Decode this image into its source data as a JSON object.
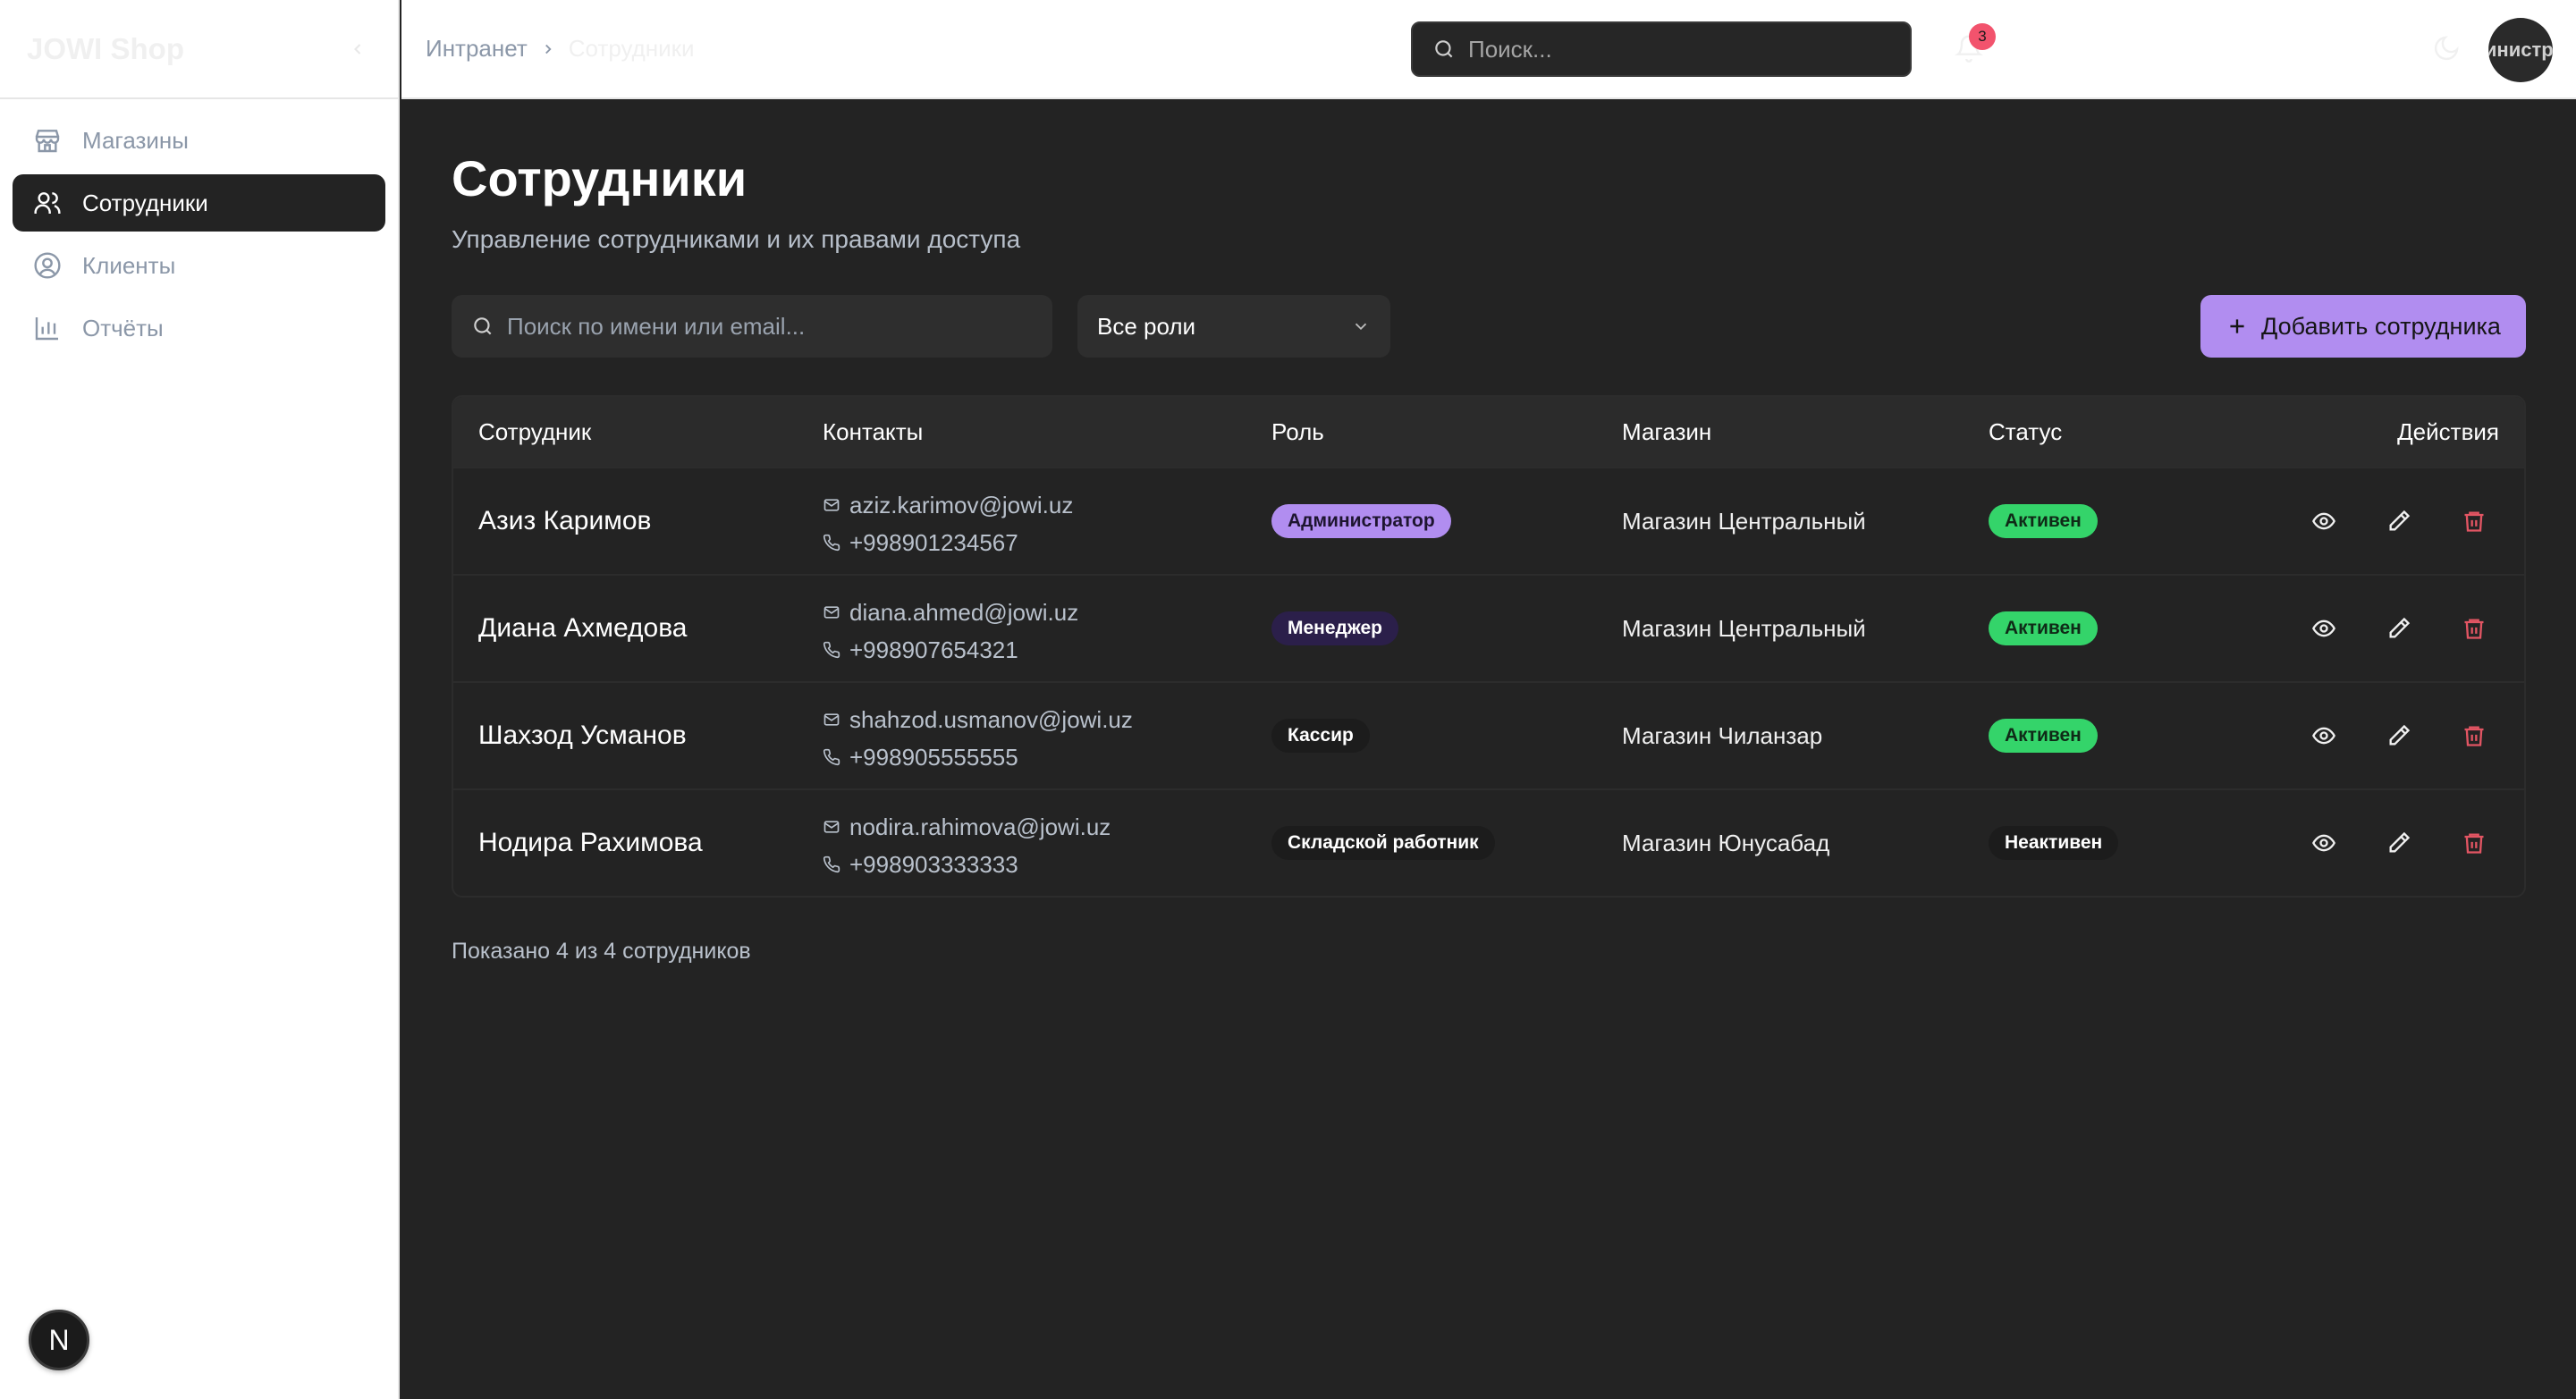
{
  "app": {
    "brand": "JOWI Shop"
  },
  "sidebar": {
    "items": [
      {
        "label": "Магазины",
        "icon": "store-icon",
        "active": false
      },
      {
        "label": "Сотрудники",
        "icon": "users-icon",
        "active": true
      },
      {
        "label": "Клиенты",
        "icon": "user-circle-icon",
        "active": false
      },
      {
        "label": "Отчёты",
        "icon": "bar-chart-icon",
        "active": false
      }
    ],
    "dev_badge": "N"
  },
  "topbar": {
    "breadcrumb": {
      "root": "Интранет",
      "current": "Сотрудники"
    },
    "search_placeholder": "Поиск...",
    "notifications_count": "3",
    "avatar_text": "Администратор"
  },
  "page": {
    "title": "Сотрудники",
    "subtitle": "Управление сотрудниками и их правами доступа",
    "search_placeholder": "Поиск по имени или email...",
    "role_filter": "Все роли",
    "add_button": "Добавить сотрудника",
    "footer": "Показано 4 из 4 сотрудников"
  },
  "table": {
    "headers": [
      "Сотрудник",
      "Контакты",
      "Роль",
      "Магазин",
      "Статус",
      "Действия"
    ],
    "rows": [
      {
        "name": "Азиз Каримов",
        "email": "aziz.karimov@jowi.uz",
        "phone": "+998901234567",
        "role": "Администратор",
        "shop": "Магазин Центральный",
        "status": "Активен"
      },
      {
        "name": "Диана Ахмедова",
        "email": "diana.ahmed@jowi.uz",
        "phone": "+998907654321",
        "role": "Менеджер",
        "shop": "Магазин Центральный",
        "status": "Активен"
      },
      {
        "name": "Шахзод Усманов",
        "email": "shahzod.usmanov@jowi.uz",
        "phone": "+998905555555",
        "role": "Кассир",
        "shop": "Магазин Чиланзар",
        "status": "Активен"
      },
      {
        "name": "Нодира Рахимова",
        "email": "nodira.rahimova@jowi.uz",
        "phone": "+998903333333",
        "role": "Складской работник",
        "shop": "Магазин Юнусабад",
        "status": "Неактивен"
      }
    ]
  },
  "colors": {
    "accent": "#b18df0",
    "active_status": "#34d46a",
    "delete": "#e25563",
    "role_admin": "#b18df0",
    "role_manager": "#2b1f4a"
  }
}
